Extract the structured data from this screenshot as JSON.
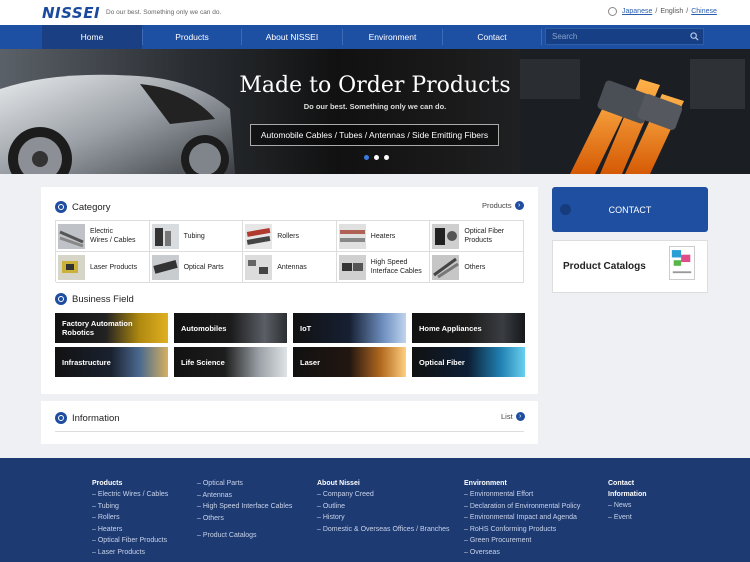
{
  "header": {
    "logo": "NISSEI",
    "tagline": "Do our best.  Something only we can do.",
    "languages": [
      "Japanese",
      "English",
      "Chinese"
    ],
    "separator": "/"
  },
  "nav": {
    "items": [
      "Home",
      "Products",
      "About NISSEI",
      "Environment",
      "Contact"
    ],
    "search_placeholder": "Search"
  },
  "hero": {
    "title": "Made to Order Products",
    "subtitle": "Do our best. Something only we can do.",
    "tags": "Automobile Cables / Tubes / Antennas / Side Emitting Fibers"
  },
  "category": {
    "heading": "Category",
    "more": "Products",
    "items": [
      [
        "Electric",
        "Wires / Cables"
      ],
      [
        "Tubing"
      ],
      [
        "Rollers"
      ],
      [
        "Heaters"
      ],
      [
        "Optical Fiber",
        "Products"
      ],
      [
        "Laser Products"
      ],
      [
        "Optical Parts"
      ],
      [
        "Antennas"
      ],
      [
        "High Speed",
        "Interface Cables"
      ],
      [
        "Others"
      ]
    ]
  },
  "business": {
    "heading": "Business Field",
    "items": [
      [
        "Factory Automation",
        "Robotics"
      ],
      [
        "Automobiles"
      ],
      [
        "IoT"
      ],
      [
        "Home Appliances"
      ],
      [
        "Infrastructure"
      ],
      [
        "Life Science"
      ],
      [
        "Laser"
      ],
      [
        "Optical Fiber"
      ]
    ]
  },
  "information": {
    "heading": "Information",
    "more": "List"
  },
  "sidebar": {
    "contact": "CONTACT",
    "catalogs": "Product Catalogs"
  },
  "footer": {
    "products": {
      "heading": "Products",
      "items": [
        "Electric Wires / Cables",
        "Tubing",
        "Rollers",
        "Heaters",
        "Optical Fiber Products",
        "Laser Products"
      ]
    },
    "products2": {
      "items": [
        "Optical Parts",
        "Antennas",
        "High Speed Interface Cables",
        "Others"
      ],
      "catalogs": "Product Catalogs"
    },
    "about": {
      "heading": "About Nissei",
      "items": [
        "Company Creed",
        "Outline",
        "History",
        "Domestic & Overseas Offices / Branches"
      ]
    },
    "environment": {
      "heading": "Environment",
      "items": [
        "Environmental Effort",
        "Declaration of Environmental Policy",
        "Environmental Impact and Agenda",
        "RoHS Conforming Products",
        "Green Procurement",
        "Overseas"
      ]
    },
    "contact": {
      "heading": "Contact",
      "heading2": "Information",
      "items": [
        "News",
        "Event"
      ]
    },
    "bullet": "–"
  }
}
